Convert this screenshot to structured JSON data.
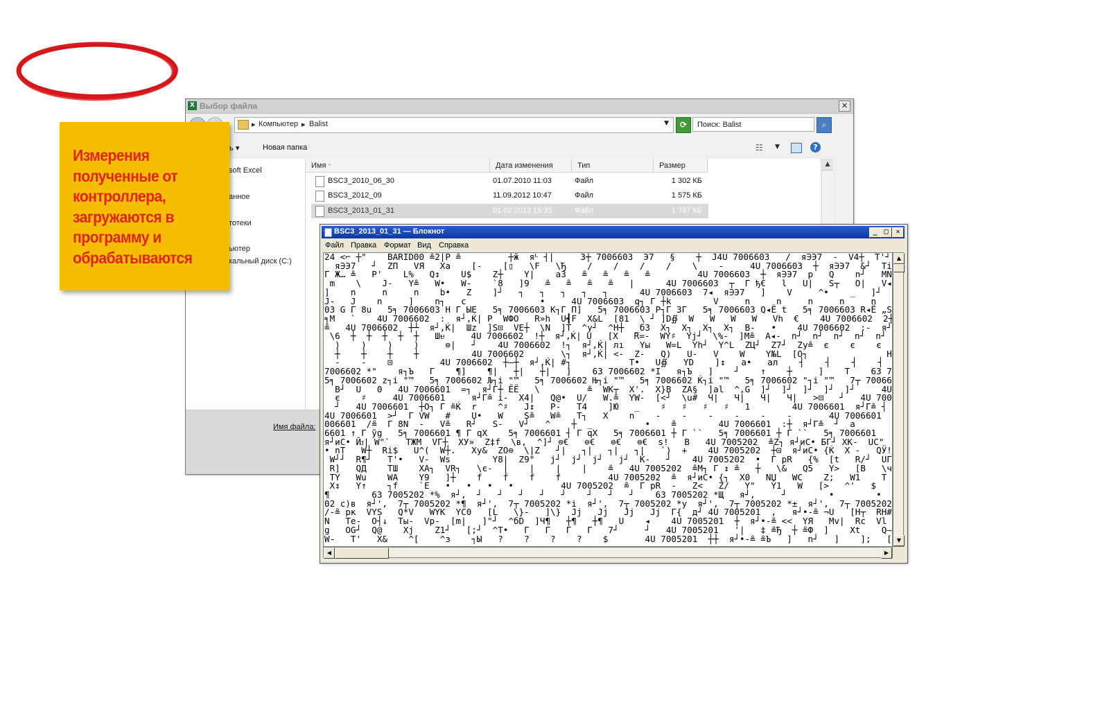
{
  "file_dialog": {
    "title": "Выбор файла",
    "breadcrumbs": [
      "Компьютер",
      "Balist"
    ],
    "search_placeholder": "Поиск: Balist",
    "toolbar": {
      "organize_label": "ть",
      "new_folder_label": "Новая папка"
    },
    "nav_items": [
      "soft Excel",
      "анное",
      "тотеки",
      "ьютер",
      "кальный диск (C:)"
    ],
    "columns": [
      "Имя",
      "Дата изменения",
      "Тип",
      "Размер"
    ],
    "files": [
      {
        "name": "BSC3_2010_06_30",
        "date": "01.07.2010 11:03",
        "type": "Файл",
        "size": "1 302 КБ"
      },
      {
        "name": "BSC3_2012_09",
        "date": "11.09.2012 10:47",
        "type": "Файл",
        "size": "1 575 КБ"
      },
      {
        "name": "BSC3_2013_01_31",
        "date": "01.02.2013 15:35",
        "type": "Файл",
        "size": "1 797 КБ"
      }
    ],
    "selected_file": "BSC3_2013_01_31",
    "filename_label": "Имя файла:"
  },
  "sticky_note": {
    "text": "Измерения\nполученные от\nконтроллера,\nзагружаются в\nпрограмму и\nобрабатываются",
    "color": "#f7bd00",
    "text_color": "#e0261b"
  },
  "notepad": {
    "title": "BSC3_2013_01_31 — Блокнот",
    "menu": [
      "Файл",
      "Правка",
      "Формат",
      "Вид",
      "Справка"
    ],
    "lines": [
      "24 <⌐ ┼\"    BARID00 ≗2|P ≗         ┼ӂ  яᒡ ┤|     3┼ 7006603  Э7   §    ┼  J4U 7006603   /  я∋Э7  -  V4┼  T'┘  UЫ",
      "  я∋Э7   ┘  ZП   VЯ   Xa    [-    [▯   \\F   \\Ђ    /    /    /    /    \\    -     4U 7006603  ┼  я∋Э7  &┘  Ti   NA",
      "Г Ж… ≗   P'    L%   Q↕    U$    Z┼    Y|    a3   ≗   ≗   ≗   ≗         4U 7006603  ┼  я∋Э7  p   Q    n┘   MN",
      " m    \\    J-   Y≗   W•   W-    `8   ]9   ≗   ≗   ≗   ≗   |      4U 7006603  ┬  Г ђ€   l   U|   S┬   O|   V◂",
      "]    n     n     n    b•   Z    ]┘   ┐   ┐   ┐   ┐   ┐      4U 7006603  7◂  я∋Э7   ]    V     ^•    _   ]┘   [",
      "J-   J    n     ]    n┐   c              •     4U 7006603  q┐ Г ┼k        V     n     n     n     n     n",
      "03 G Г 8u   5╕ 7006603 H Г ЫE   5╕ 7006603 K┐Г П]   5╕ 7006603 P┐Г 3Г   5╕ 7006603 Q◂Ё t   5╕ 7006603 R◂Ё „S   5╕ 7",
      "╕M   `    4U 7006602  :  я┘,Ќ| P  WФO   R»h  U┫F  X&L  [81  \\ ┘ ]D∯  W   W   W   W   Vh  €    4U 7006602  2┼  я┘,Ќ|",
      "≗   4U 7006602  ┼┴  я┘,Ќ|  Шz  ]S⊡  VE┼  \\N  ]T  ^у┘  ^H┼  _б3  X┐  X┐  X┐  X┐  B-   •    4U 7006602  :-  я┘,Ќ| dz",
      " \\6  ┼  ┼  ┼  ┼  ┼   Шᵾ     4U 7006602  !┼  я┘,Ќ| U   [X   R=-  WY♯  Yj┘  \\%-  ]M≗  A◂-  n┘  n┘  n┘  n┘  n┘  n┘",
      "  )    )    )    )     ⊜|   ┘    4U 7006602  !┐  я┘,Ќ| лı   Yы   W=L  Yh┘  Y^L  ZЦ┘  Z7┘  Zy≗  є    є    є    є    й",
      "  ┼    ┼    ┼    ┼          4U 7006602       \\┐  я┘,Ќ| <-  Z-   Q)   U-   V    W    Y№L  [O┐               H    l",
      "  -    -    ⊡         4U 7006602  ┼—┼  я┘,Ќ| #┐           T•   U∯   YD    ]↕   a•   ал    ┤    ┤    ┤    ┤        4U 7006",
      "7006602 *\"    я┐Ъ   Г    ¶]    ¶|   ┼|   ┼|   ]    63 7006602 *I   я┐Ъ   ]    ┘    ↑    ┼     ]    T    63 7006602 *є",
      "5╕ 7006602 z┐i \"™   5╕ 7006602 Љ┐i \"™   5╕ 7006602 Њ┐i \"™   5╕ 7006602 Ќ┐i \"™   5╕ 7006602 \"┐i \"™   7┬ 7006602 *",
      "  B┘  U   0   4U 7006601  =┐  я┘Г┼ ЁЁ   \\         ≗  WK┬  X'.  X}B  ZA§  ]al  ^,G  ]┘  ]┘  ]┘  ]┘  ]┘     4U",
      "  є    ♯     4U 7006601     я┘Г≗ i-  X4|   Q@•  U/   W.≗  YW-  [<┘  \\u#  Ч|   Ч|   Ч|   Ч|   >⊡   ┘   4U 7006601  :|",
      "  ┘   4U 7006601  ┼O┐ Г ≗Ќ  r    ^♯   J↕   P-   T4    ]Ю   _    ♯   ♯   ♯   ♯   1        4U 7006601  я┘Г≗ ┤ ♯",
      "4U 7006601  >┘  Г VW   #    U•   W    S≗   W≗   T┐   X    n    -    -    -    -    -    -       4U 7006601  -  я┘Г≗ W",
      "006601  /≗  Г 8N  -   V≗   R┘   S-   V┘   ^    ┼  _          •    ≗        4U 7006601  :┼  я┘Г≗  ┘  a",
      "6601 ↑ Г ỹg   5╕ 7006601 ¶ Г qX    5╕ 7006601 ┤ Г qX   5╕ 7006601 ┼ Г ``   5╕ 7006601 ┼ Г ``   5╕ 7006601   Г AL",
      "я┘иС• Йᴊ| W\"`   ТЖМ  VГ┼  XУ»  Z‡f  \\в,  ^]┘ ⊜€   ⊜€   ⊜€   ⊜€  s!   B   4U 7005202  ≗Z┐ я┘иС• БГ┘ XK-  UC\"   WЁы",
      "• nT   W┼  Ri$   U^(  W┼.   Xу&  ZO⊜  \\|Z   ┘|   ┐|   ┐|   ┐|   `)  +    4U 7005202  ┼⊡  я┘иС• {Ќ  X -   QӰ!  T€  X. - Z",
      " W┘┘  R¶┘   T'•   V-  Ws        Y8|  Z9\"   j┘  j┘  j┘   j┘  Ќ-   ┘    4U 7005202  •  Г pR   {%  [t   R/┘  UГ|  Y.",
      " R]   QД    ТШ    ХА┐  VR┐   \\є-  |    |    |    |    ≗   4U 7005202  ≗M┐ Г ↕ ≗   ┼   \\&   Q5   Y>   [B   \\ч",
      " TY   Wu    WA    Y9   ]┼    f    f    f    f         4U 7005202  ≗  я┘иС• {┐  X0   NЏ   WC    Z;   W1    T   \\Ё",
      " X↕   Y↑    ┐f    `E   •   •   •   •         4U 7005202  ≗  Г pR  -   Z<   Z/   Y\"   Y1   W   [>   ^'   $",
      "¶        63 7005202 *%  я┘,  ┘   ┘   ┘   ┘   ┘    ┘   ┘   ┘    63 7005202 *Щ   я┘,     ┘        •        •",
      "02 с)в  я┘',  7┬ 7005202 *¶  я┘',  7┬ 7005202 *i  я┘',  7┬ 7005202 *y  я┘',  7┬ 7005202 *±  я┘',  7┬ 7005202 *Ғ",
      "/-≗ рк  VYS   Q*V   WYK  YC0   [L   \\}-   ]\\}  Jj   Jj   Jj   Jj  Г{  д┘ 4U 7005201  ,   я┘•-≗ ¬U   [H┬  RH#  X.  Y",
      "N   Te-  O┤↓  Ты-  Vp-  [m|   ]\"┘  ^бD  ]Ч¶   ┼¶   ┼¶   U    ◂    4U 7005201  ┼  я┘•-≗ <<  YЯ   Mv|  Rc  Vl  Y≗|  \\",
      "g   OG┘  Q@    Xj    Z1┘   [;┘  ^T•   Г   Г   Г   Г   7┘     ┘   4U 7005201   '|   ‡ ≗Ђ  ┼ ≗Ф  ]    Xt    Q—   Рй   XM",
      "W-   T'   X&    ^[    ^з    ┐Ы   ?    ?    ?    ?    $       4U 7005201  ┼┼  я┘•-≗ ≗Ъ   ]   n┘   ]    ];   [є   \\'"
    ]
  }
}
